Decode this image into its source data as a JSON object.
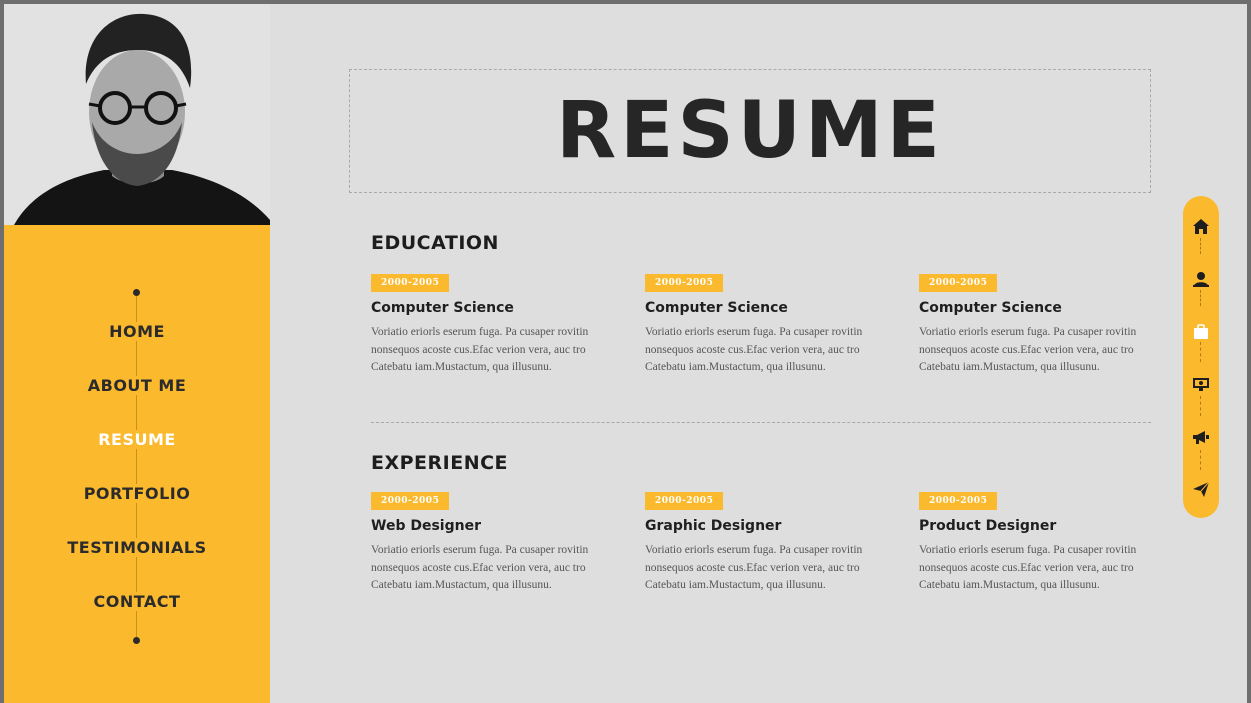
{
  "nav": {
    "items": [
      {
        "label": "HOME",
        "active": false
      },
      {
        "label": "ABOUT ME",
        "active": false
      },
      {
        "label": "RESUME",
        "active": true
      },
      {
        "label": "PORTFOLIO",
        "active": false
      },
      {
        "label": "TESTIMONIALS",
        "active": false
      },
      {
        "label": "CONTACT",
        "active": false
      }
    ]
  },
  "header": {
    "title": "RESUME"
  },
  "education": {
    "heading": "EDUCATION",
    "entries": [
      {
        "date": "2000-2005",
        "title": "Computer Science",
        "text": "Voriatio eriorls eserum fuga. Pa cusaper rovitin nonsequos acoste cus.Efac verion vera, auc tro Catebatu iam.Mustactum, qua illusunu."
      },
      {
        "date": "2000-2005",
        "title": "Computer Science",
        "text": "Voriatio eriorls eserum fuga. Pa cusaper rovitin nonsequos acoste cus.Efac verion vera, auc tro Catebatu iam.Mustactum, qua illusunu."
      },
      {
        "date": "2000-2005",
        "title": "Computer Science",
        "text": "Voriatio eriorls eserum fuga. Pa cusaper rovitin nonsequos acoste cus.Efac verion vera, auc tro Catebatu iam.Mustactum, qua illusunu."
      }
    ]
  },
  "experience": {
    "heading": "EXPERIENCE",
    "entries": [
      {
        "date": "2000-2005",
        "title": "Web Designer",
        "text": "Voriatio eriorls eserum fuga. Pa cusaper rovitin nonsequos acoste cus.Efac verion vera, auc tro Catebatu iam.Mustactum, qua illusunu."
      },
      {
        "date": "2000-2005",
        "title": "Graphic Designer",
        "text": "Voriatio eriorls eserum fuga. Pa cusaper rovitin nonsequos acoste cus.Efac verion vera, auc tro Catebatu iam.Mustactum, qua illusunu."
      },
      {
        "date": "2000-2005",
        "title": "Product Designer",
        "text": "Voriatio eriorls eserum fuga. Pa cusaper rovitin nonsequos acoste cus.Efac verion vera, auc tro Catebatu iam.Mustactum, qua illusunu."
      }
    ]
  },
  "iconbar": {
    "icons": [
      "home-icon",
      "user-icon",
      "briefcase-icon",
      "portfolio-icon",
      "megaphone-icon",
      "send-icon"
    ],
    "active": "briefcase-icon"
  },
  "colors": {
    "accent": "#fbb92e",
    "background": "#dedede",
    "text_dark": "#262626",
    "active_nav": "#ffffff"
  }
}
